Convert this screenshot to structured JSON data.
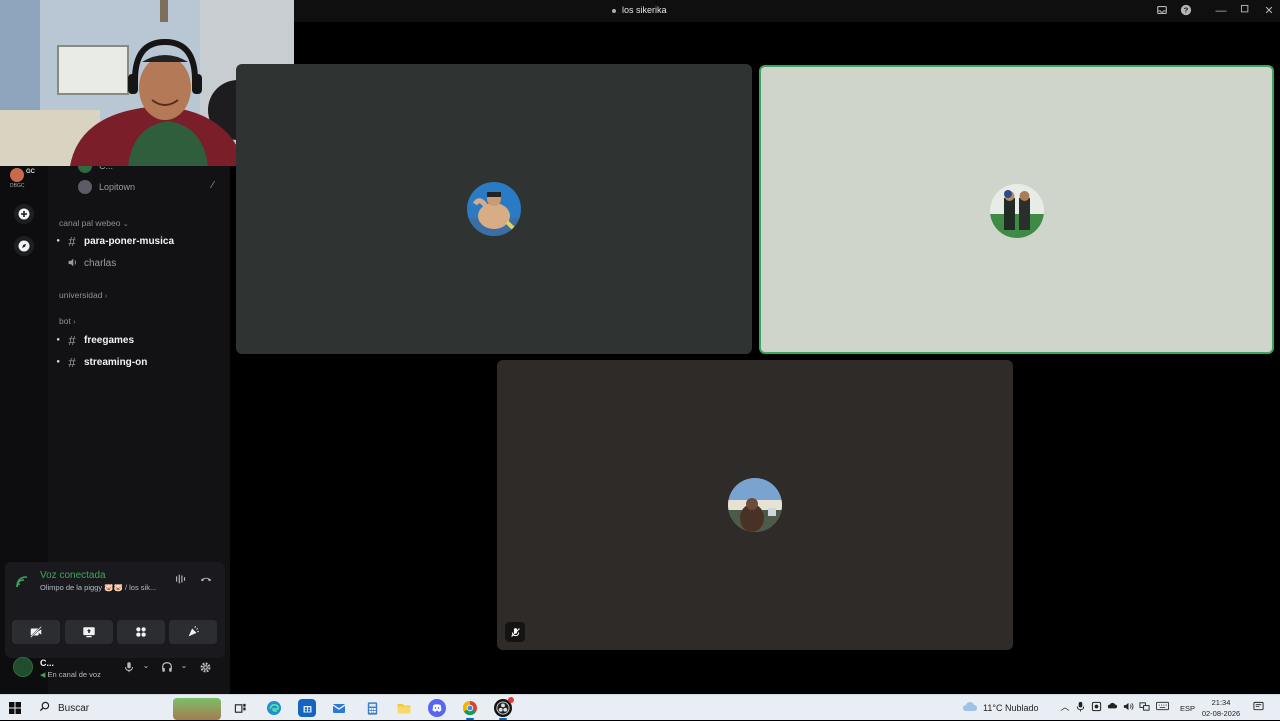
{
  "window": {
    "title": "los sikerika"
  },
  "server": {
    "short": "GC",
    "tag": "DBGC"
  },
  "sidebar": {
    "voice_users": [
      {
        "name": "C..."
      },
      {
        "name": "Lopitown"
      }
    ],
    "categories": [
      {
        "name": "canal pal webeo",
        "channels": [
          {
            "name": "para-poner-musica",
            "type": "text",
            "unread": true
          },
          {
            "name": "charlas",
            "type": "voice",
            "unread": false
          }
        ]
      },
      {
        "name": "universidad",
        "collapsed": true,
        "channels": []
      },
      {
        "name": "bot",
        "collapsed": true,
        "channels": [
          {
            "name": "freegames",
            "type": "text",
            "unread": true
          },
          {
            "name": "streaming-on",
            "type": "text",
            "unread": true
          }
        ]
      }
    ]
  },
  "voice_panel": {
    "status": "Voz conectada",
    "location": "Olimpo de la piggy 🐷🐷 / los sik...",
    "status_color": "#3ba55d"
  },
  "user": {
    "name": "C...",
    "status": "En canal de voz"
  },
  "tiles": [
    {
      "id": "user-a",
      "speaking": false,
      "muted": false
    },
    {
      "id": "user-b",
      "speaking": true,
      "muted": false
    },
    {
      "id": "user-c",
      "speaking": false,
      "muted": true
    }
  ],
  "taskbar": {
    "search_placeholder": "Buscar",
    "weather": "11°C",
    "weather_text": "Nublado",
    "language": "ESP",
    "time": "21:34",
    "date": "02-08-2026"
  }
}
